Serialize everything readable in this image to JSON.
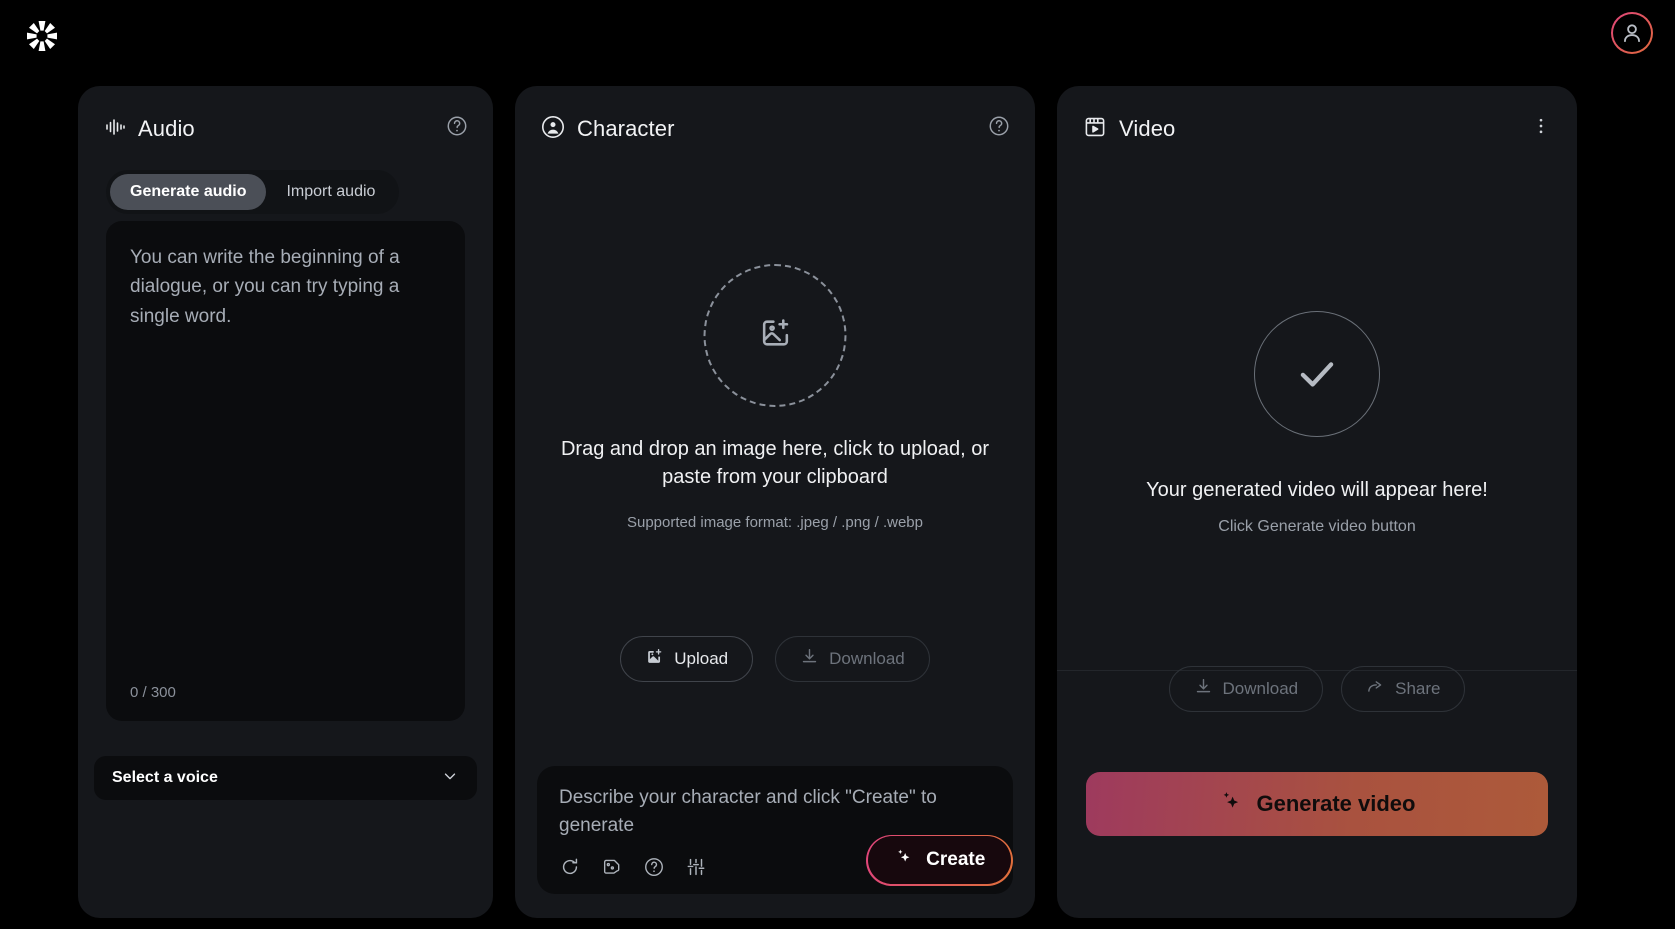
{
  "app": {
    "logo_icon": "flower-logo-icon",
    "avatar_icon": "user-avatar-icon"
  },
  "audio_panel": {
    "title": "Audio",
    "title_icon": "audio-waveform-icon",
    "help_icon": "help-circle-icon",
    "tabs": [
      {
        "label": "Generate audio",
        "active": true
      },
      {
        "label": "Import audio",
        "active": false
      }
    ],
    "textarea_placeholder": "You can write the beginning of a dialogue, or you can try typing a single word.",
    "char_count": "0 / 300",
    "voice_select": {
      "label": "Select a voice",
      "chevron_icon": "chevron-down-icon"
    }
  },
  "character_panel": {
    "title": "Character",
    "title_icon": "user-circle-icon",
    "help_icon": "help-circle-icon",
    "dropzone_icon": "image-add-icon",
    "dropzone_text": "Drag and drop an image here, click to upload, or paste from your clipboard",
    "dropzone_sub": "Supported image format: .jpeg / .png / .webp",
    "buttons": [
      {
        "label": "Upload",
        "icon": "image-add-icon",
        "disabled": false
      },
      {
        "label": "Download",
        "icon": "download-icon",
        "disabled": true
      }
    ],
    "prompt_placeholder": "Describe your character and click \"Create\" to generate",
    "tools": [
      "refresh-icon",
      "dice-icon",
      "help-circle-icon",
      "sliders-icon"
    ],
    "create_button": {
      "label": "Create",
      "icon": "sparkles-icon"
    }
  },
  "video_panel": {
    "title": "Video",
    "title_icon": "clapperboard-play-icon",
    "menu_icon": "more-vertical-icon",
    "status_icon": "check-circle-icon",
    "status_text": "Your generated video will appear here!",
    "status_sub": "Click Generate video button",
    "buttons": [
      {
        "label": "Download",
        "icon": "download-icon",
        "disabled": true
      },
      {
        "label": "Share",
        "icon": "share-icon",
        "disabled": true
      }
    ],
    "generate_button": {
      "label": "Generate video",
      "icon": "sparkles-icon"
    }
  },
  "colors": {
    "background": "#000000",
    "panel": "#15171b",
    "inset": "#0b0c0e",
    "accent_pink": "#e0457b",
    "accent_orange": "#e0703a",
    "text_primary": "#f0f1f3",
    "text_muted": "#9aa0a9"
  }
}
